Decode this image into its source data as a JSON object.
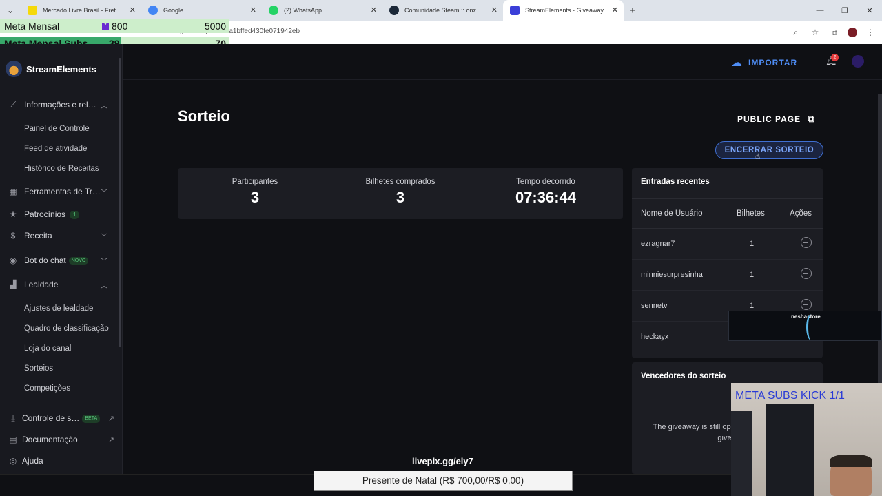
{
  "browser": {
    "tabs": [
      {
        "title": "Mercado Livre Brasil - Frete Grátis",
        "favicon_color": "#f5d90a"
      },
      {
        "title": "Google",
        "favicon_color": "#4285f4"
      },
      {
        "title": "(2) WhatsApp",
        "favicon_color": "#25d366"
      },
      {
        "title": "Comunidade Steam :: onze :: Im",
        "favicon_color": "#1b2838"
      },
      {
        "title": "StreamElements - Giveaway",
        "favicon_color": "#3b3fd8"
      }
    ],
    "url": "streamelements.com/dashboard/giveaways/6b4da1bffed430fe071942eb"
  },
  "overlay": {
    "meta1": {
      "label": "Meta Mensal",
      "kick_value": "800",
      "goal": "5000"
    },
    "meta2": {
      "label": "Meta Mensal Subs",
      "current": "39",
      "goal": "70"
    },
    "livepix": "livepix.gg/ely7",
    "donation": "Presente de Natal (R$ 700,00/R$ 0,00)",
    "nesha": "neshastore",
    "webcam_title": "META SUBS KICK 1/1"
  },
  "sidebar": {
    "brand": "StreamElements",
    "groups": [
      {
        "label": "Informações e rel…",
        "icon": "chart-line-icon"
      },
      {
        "label": "Ferramentas de Tr…",
        "icon": "tools-icon"
      },
      {
        "label": "Patrocínios",
        "icon": "star-icon",
        "badge": "1"
      },
      {
        "label": "Receita",
        "icon": "dollar-icon"
      },
      {
        "label": "Bot do chat",
        "icon": "bot-icon",
        "badge": "NOVO"
      },
      {
        "label": "Lealdade",
        "icon": "loyalty-icon"
      },
      {
        "label": "Controle de s…",
        "icon": "download-icon",
        "badge": "BETA"
      },
      {
        "label": "Documentação",
        "icon": "doc-icon"
      },
      {
        "label": "Ajuda",
        "icon": "help-icon"
      }
    ],
    "sub_info": [
      "Painel de Controle",
      "Feed de atividade",
      "Histórico de Receitas"
    ],
    "sub_loyalty": [
      "Ajustes de lealdade",
      "Quadro de classificação",
      "Loja do canal",
      "Sorteios",
      "Competições"
    ]
  },
  "topbar": {
    "import_label": "IMPORTAR",
    "notifications": "2"
  },
  "main": {
    "title": "Sorteio",
    "public_page": "PUBLIC PAGE",
    "end_button": "ENCERRAR SORTEIO",
    "stats": [
      {
        "label": "Participantes",
        "value": "3"
      },
      {
        "label": "Bilhetes comprados",
        "value": "3"
      },
      {
        "label": "Tempo decorrido",
        "value": "07:36:44"
      }
    ],
    "entries": {
      "title": "Entradas recentes",
      "columns": [
        "Nome de Usuário",
        "Bilhetes",
        "Ações"
      ],
      "rows": [
        {
          "user": "ezragnar7",
          "tickets": "1"
        },
        {
          "user": "minniesurpresinha",
          "tickets": "1"
        },
        {
          "user": "sennetv",
          "tickets": "1"
        },
        {
          "user": "heckayx",
          "tickets": ""
        }
      ]
    },
    "winners": {
      "title": "Vencedores do sorteio",
      "message": "The giveaway is still op… you must close the give…"
    }
  }
}
